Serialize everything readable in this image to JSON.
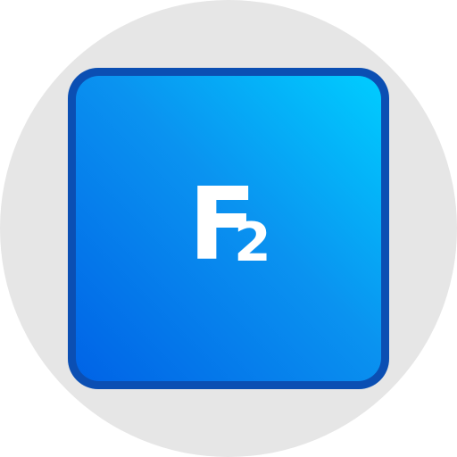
{
  "key": {
    "letter": "F",
    "subscript": "2",
    "colors": {
      "background_circle": "#e6e6e6",
      "border": "#0b4fb3",
      "gradient_top_right": "#00cdff",
      "gradient_bottom_left": "#0063e6",
      "text": "#ffffff"
    }
  }
}
